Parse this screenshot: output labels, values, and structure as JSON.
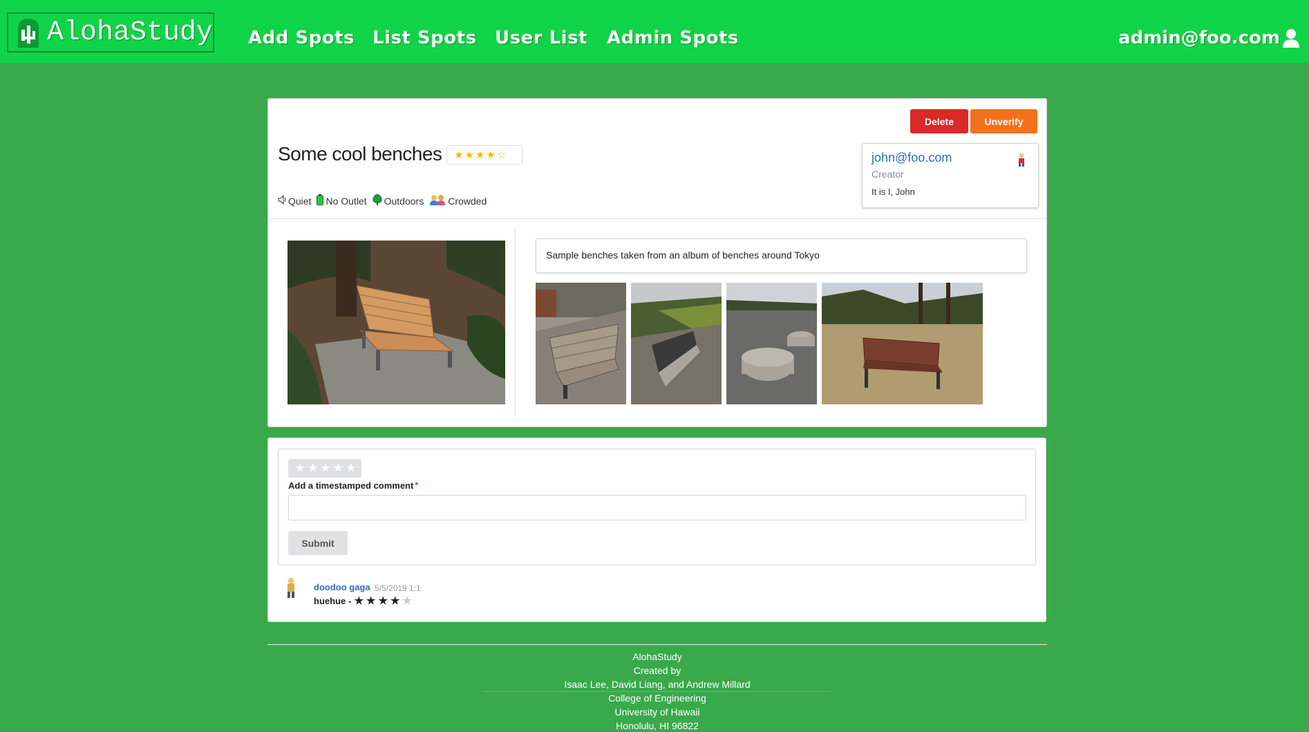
{
  "navbar": {
    "brand": "AlohaStudy",
    "links": [
      "Add Spots",
      "List Spots",
      "User List",
      "Admin Spots"
    ],
    "user": "admin@foo.com"
  },
  "spot": {
    "title": "Some cool benches",
    "rating": 4,
    "max_rating": 5,
    "buttons": {
      "delete": "Delete",
      "unverify": "Unverify"
    },
    "tags": [
      {
        "icon": "speaker-icon",
        "label": "Quiet"
      },
      {
        "icon": "battery-icon",
        "label": "No Outlet"
      },
      {
        "icon": "tree-icon",
        "label": "Outdoors"
      },
      {
        "icon": "people-icon",
        "label": "Crowded"
      }
    ],
    "creator": {
      "email": "john@foo.com",
      "role": "Creator",
      "bio": "It is I, John"
    },
    "description": "Sample benches taken from an album of benches around Tokyo",
    "colors": {
      "delete": "#db2828",
      "unverify": "#f2711c",
      "link": "#2b6fb5",
      "star": "#ffb70a"
    }
  },
  "comment_form": {
    "label": "Add a timestamped comment",
    "required_mark": "*",
    "input_value": "",
    "submit": "Submit"
  },
  "comments": [
    {
      "author": "doodoo gaga",
      "date": "5/5/2019 1:1",
      "text": "huehue",
      "separator": "-",
      "rating": 4
    }
  ],
  "footer": {
    "line1": "AlohaStudy",
    "line2": "Created by",
    "line3": "Isaac Lee, David Liang, and Andrew Millard",
    "line4": "College of Engineering",
    "line5": "University of Hawaii",
    "line6": "Honolulu, HI 96822"
  }
}
